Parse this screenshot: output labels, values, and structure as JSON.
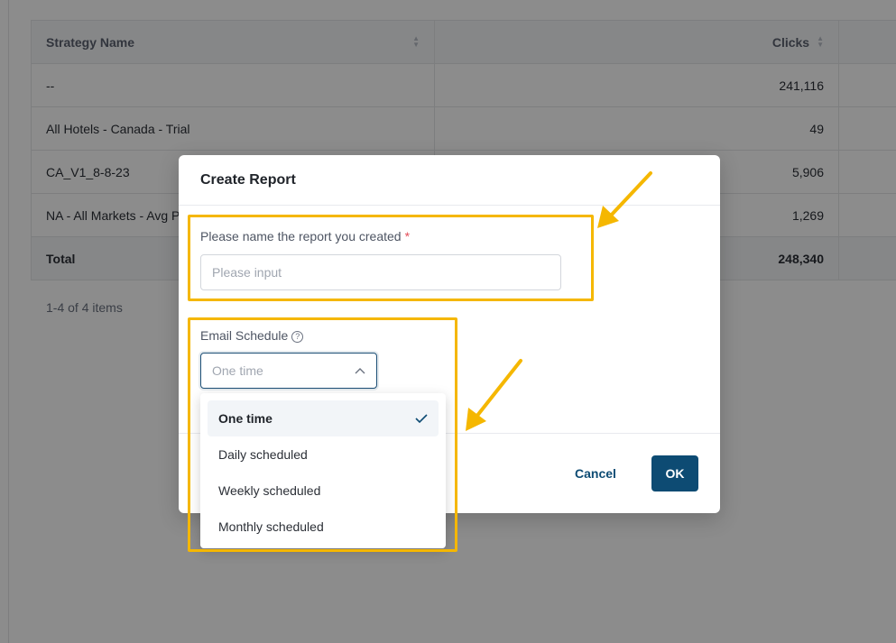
{
  "table": {
    "headers": {
      "strategy_name": "Strategy Name",
      "clicks": "Clicks"
    },
    "rows": [
      {
        "strategy": "--",
        "clicks": "241,116"
      },
      {
        "strategy": "All Hotels - Canada - Trial",
        "clicks": "49"
      },
      {
        "strategy": "CA_V1_8-8-23",
        "clicks": "5,906"
      },
      {
        "strategy": "NA - All Markets - Avg P",
        "clicks": "1,269"
      }
    ],
    "total": {
      "label": "Total",
      "clicks": "248,340"
    },
    "pagination": "1-4 of 4 items"
  },
  "modal": {
    "title": "Create Report",
    "name_field": {
      "label": "Please name the report you created",
      "required_mark": "*",
      "placeholder": "Please input",
      "value": ""
    },
    "schedule_field": {
      "label": "Email Schedule",
      "help_icon": "question-circle-icon",
      "selected": "One time"
    },
    "dropdown_options": [
      {
        "label": "One time",
        "selected": true
      },
      {
        "label": "Daily scheduled",
        "selected": false
      },
      {
        "label": "Weekly scheduled",
        "selected": false
      },
      {
        "label": "Monthly scheduled",
        "selected": false
      }
    ],
    "buttons": {
      "cancel": "Cancel",
      "ok": "OK"
    }
  },
  "colors": {
    "primary": "#0d4b73",
    "highlight": "#f5b700",
    "required": "#e34d59"
  }
}
